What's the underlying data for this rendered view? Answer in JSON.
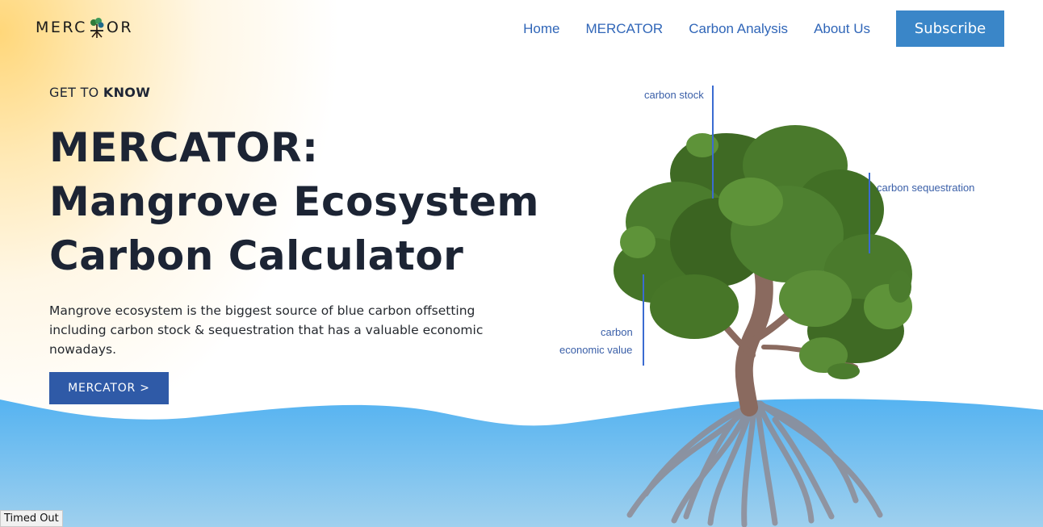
{
  "brand": {
    "logo_text_left": "MERC",
    "logo_text_right": "OR",
    "logo_icon": "mangrove-tree-icon"
  },
  "nav": {
    "items": [
      "Home",
      "MERCATOR",
      "Carbon Analysis",
      "About Us"
    ],
    "subscribe_label": "Subscribe"
  },
  "hero": {
    "eyebrow_prefix": "GET TO ",
    "eyebrow_bold": "KNOW",
    "title_line1": "MERCATOR:",
    "title_line2": "Mangrove Ecosystem",
    "title_line3": "Carbon Calculator",
    "description": "Mangrove ecosystem is the biggest source of blue carbon offsetting including carbon stock & sequestration that has a valuable economic nowadays.",
    "cta_label": "MERCATOR >"
  },
  "illustration": {
    "label_stock": "carbon stock",
    "label_sequestration": "carbon sequestration",
    "label_economic_1": "carbon",
    "label_economic_2": "economic value"
  },
  "status": {
    "text": "Timed Out"
  },
  "colors": {
    "accent": "#3a86c8",
    "cta": "#2f5aa7",
    "nav_link": "#3066b8",
    "water": "#5bb6f0",
    "foliage": "#4a7a2c"
  }
}
